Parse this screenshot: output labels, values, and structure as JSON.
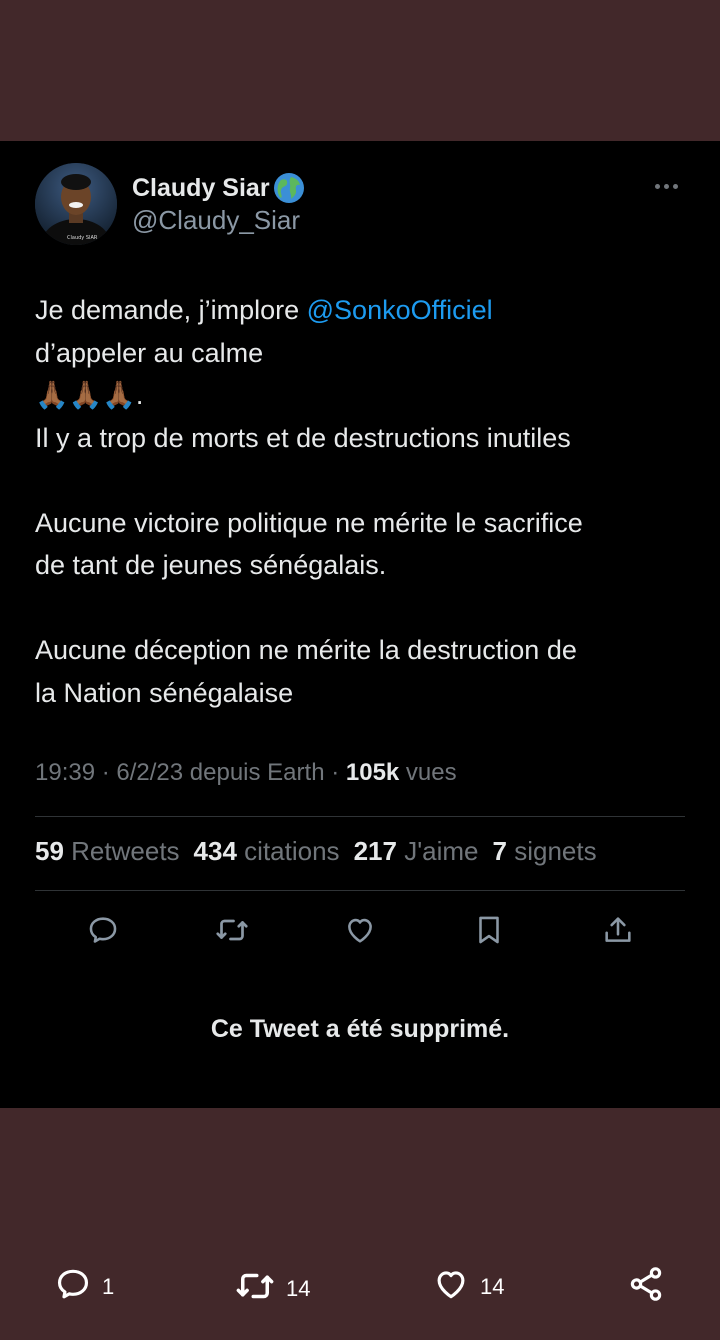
{
  "tweet": {
    "display_name": "Claudy Siar",
    "handle": "@Claudy_Siar",
    "avatar_caption": "Claudy SIAR",
    "text": {
      "l1a": "Je demande, j’implore ",
      "l1_mention": "@SonkoOfficiel",
      "l2": "d’appeler au calme",
      "l3": "🙏🏾🙏🏾🙏🏾.",
      "l4": "Il y a trop de morts et de destructions inutiles",
      "l5": "Aucune victoire politique ne mérite le sacrifice",
      "l6": "de tant de jeunes sénégalais.",
      "l7": "Aucune déception ne mérite la destruction de",
      "l8": "la Nation sénégalaise"
    },
    "meta": {
      "time_date_source": "19:39 · 6/2/23 depuis Earth · ",
      "views_count": "105k",
      "views_label": " vues"
    },
    "stats": {
      "retweets_count": "59",
      "retweets_label": "Retweets",
      "quotes_count": "434",
      "quotes_label": "citations",
      "likes_count": "217",
      "likes_label": "J'aime",
      "bookmarks_count": "7",
      "bookmarks_label": "signets"
    },
    "deleted_notice": "Ce Tweet a été supprimé."
  },
  "bottom_bar": {
    "reply_count": "1",
    "retweet_count": "14",
    "like_count": "14"
  },
  "colors": {
    "background": "#42282a",
    "card": "#000000",
    "text": "#e7e9ea",
    "muted": "#71767b",
    "mention": "#1d9bf0"
  },
  "icons": [
    "globe-icon",
    "more-icon",
    "reply-icon",
    "retweet-icon",
    "like-icon",
    "bookmark-icon",
    "share-icon"
  ]
}
